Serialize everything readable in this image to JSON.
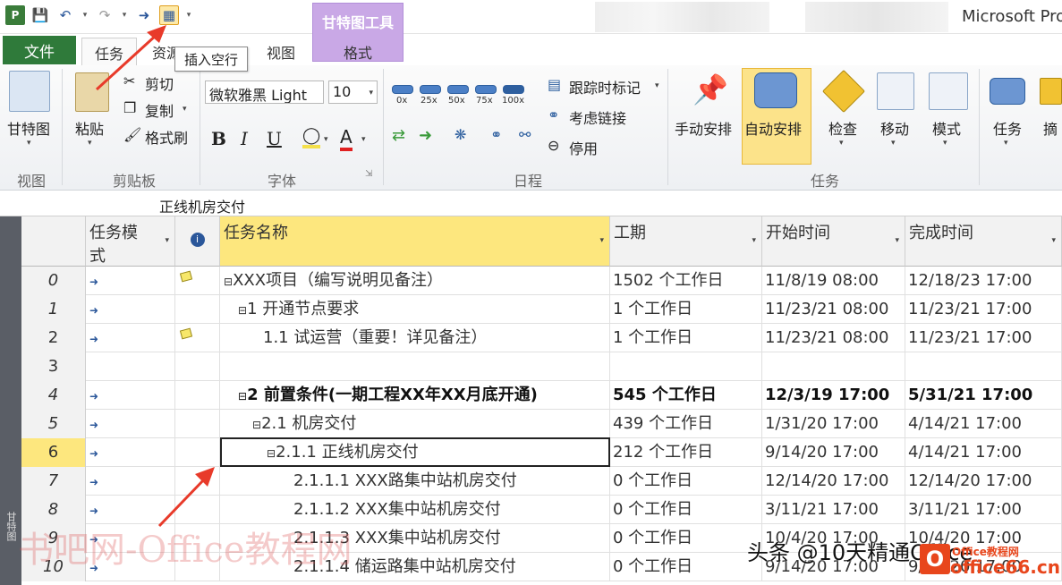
{
  "titlebar": {
    "app_title": "Microsoft Pro",
    "contextual_tab": "甘特图工具",
    "contextual_sub": "格式"
  },
  "tabs": {
    "file": "文件",
    "task": "任务",
    "resource": "资源",
    "view": "视图"
  },
  "tooltip": "插入空行",
  "ribbon": {
    "gantt_label": "甘特图",
    "paste_label": "粘贴",
    "cut_label": "剪切",
    "copy_label": "复制",
    "format_painter_label": "格式刷",
    "font_name": "微软雅黑 Light",
    "font_size": "10",
    "bold": "B",
    "italic": "I",
    "underline": "U",
    "text_a": "A",
    "pct0": "0x",
    "pct25": "25x",
    "pct50": "50x",
    "pct75": "75x",
    "pct100": "100x",
    "track_label": "跟踪时标记",
    "respect_links": "考虑链接",
    "deactivate": "停用",
    "manual": "手动安排",
    "auto": "自动安排",
    "inspect": "检查",
    "move": "移动",
    "mode": "模式",
    "task_btn": "任务",
    "summary_btn": "摘",
    "groups": {
      "view": "视图",
      "clipboard": "剪贴板",
      "font": "字体",
      "schedule": "日程",
      "tasks": "任务"
    }
  },
  "formula": {
    "value": "正线机房交付"
  },
  "grid": {
    "headers": {
      "mode_line1": "任务模",
      "mode_line2": "式",
      "name": "任务名称",
      "duration": "工期",
      "start": "开始时间",
      "finish": "完成时间"
    },
    "rows": [
      {
        "id": "0",
        "name": "XXX项目（编写说明见备注）",
        "duration": "1502 个工作日",
        "start": "11/8/19 08:00",
        "finish": "12/18/23 17:00"
      },
      {
        "id": "1",
        "name": "1 开通节点要求",
        "duration": "1 个工作日",
        "start": "11/23/21 08:00",
        "finish": "11/23/21 17:00"
      },
      {
        "id": "2",
        "name": "1.1 试运营（重要！详见备注）",
        "duration": "1 个工作日",
        "start": "11/23/21 08:00",
        "finish": "11/23/21 17:00"
      },
      {
        "id": "3",
        "name": "",
        "duration": "",
        "start": "",
        "finish": ""
      },
      {
        "id": "4",
        "name": "2 前置条件(一期工程XX年XX月底开通)",
        "duration": "545 个工作日",
        "start": "12/3/19 17:00",
        "finish": "5/31/21 17:00"
      },
      {
        "id": "5",
        "name": "2.1 机房交付",
        "duration": "439 个工作日",
        "start": "1/31/20 17:00",
        "finish": "4/14/21 17:00"
      },
      {
        "id": "6",
        "name": "2.1.1 正线机房交付",
        "duration": "212 个工作日",
        "start": "9/14/20 17:00",
        "finish": "4/14/21 17:00"
      },
      {
        "id": "7",
        "name": "2.1.1.1 XXX路集中站机房交付",
        "duration": "0 个工作日",
        "start": "12/14/20 17:00",
        "finish": "12/14/20 17:00"
      },
      {
        "id": "8",
        "name": "2.1.1.2 XXX集中站机房交付",
        "duration": "0 个工作日",
        "start": "3/11/21 17:00",
        "finish": "3/11/21 17:00"
      },
      {
        "id": "9",
        "name": "2.1.1.3 XXX集中站机房交付",
        "duration": "0 个工作日",
        "start": "10/4/20 17:00",
        "finish": "10/4/20 17:00"
      },
      {
        "id": "10",
        "name": "2.1.1.4 储运路集中站机房交付",
        "duration": "0 个工作日",
        "start": "9/14/20 17:00",
        "finish": "9/14/20 17:00"
      }
    ]
  },
  "left_bar_label": "甘特图",
  "watermark": {
    "left": "书吧网-Office教程网",
    "right": "头条 @10天精通Office",
    "logo_letter": "O",
    "logo_text": "Office教程网",
    "logo_url": "office66.cn"
  },
  "colors": {
    "file_tab": "#2f7a3a",
    "contextual": "#c9a8e6",
    "highlight": "#fde77e",
    "arrow": "#e83a2a"
  }
}
